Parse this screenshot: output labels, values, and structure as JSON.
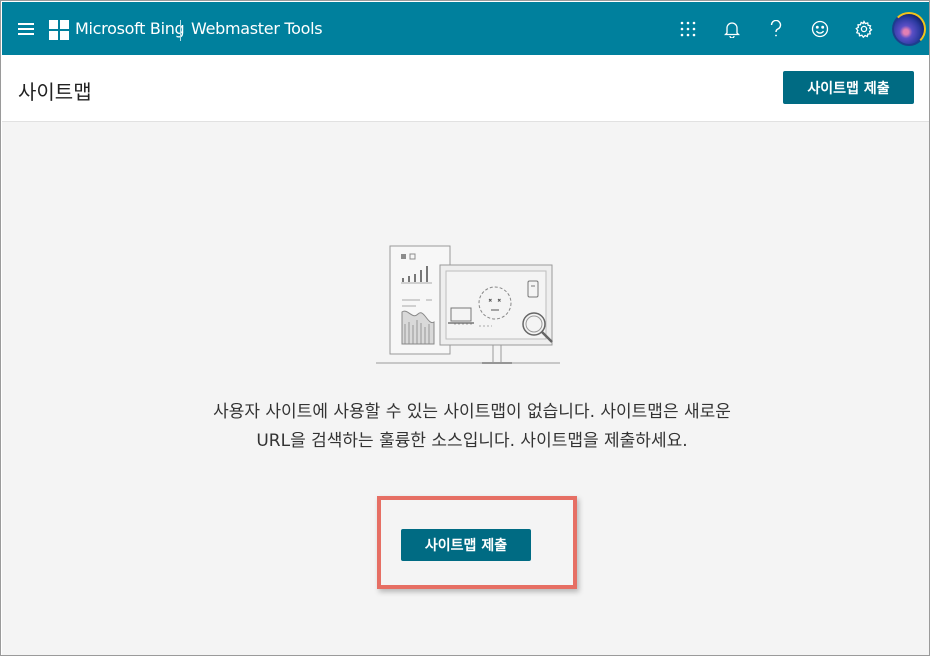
{
  "topbar": {
    "brand": "Microsoft Bing",
    "product": "Webmaster Tools",
    "icons": [
      "menu-icon",
      "microsoft-logo",
      "apps-grid-icon",
      "bell-icon",
      "help-icon",
      "smiley-icon",
      "gear-icon",
      "avatar"
    ],
    "color": "#00809d"
  },
  "header": {
    "title": "사이트맵",
    "submit_label": "사이트맵 제출"
  },
  "main": {
    "message": "사용자 사이트에 사용할 수 있는 사이트맵이 없습니다. 사이트맵은 새로운 URL을 검색하는 훌륭한 소스입니다. 사이트맵을 제출하세요.",
    "submit_label": "사이트맵 제출",
    "highlight_color": "#e66f64"
  }
}
